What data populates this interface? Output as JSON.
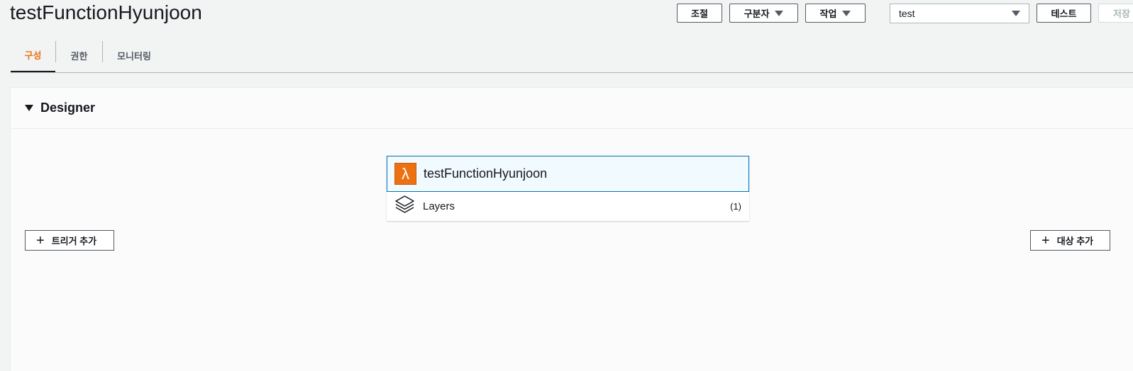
{
  "header": {
    "title": "testFunctionHyunjoon",
    "throttle_label": "조절",
    "qualifier_label": "구분자",
    "actions_label": "작업",
    "test_event_value": "test",
    "test_label": "테스트",
    "save_label": "저장"
  },
  "tabs": [
    {
      "label": "구성"
    },
    {
      "label": "권한"
    },
    {
      "label": "모니터링"
    }
  ],
  "designer": {
    "title": "Designer",
    "function_name": "testFunctionHyunjoon",
    "layers_label": "Layers",
    "layers_count": "(1)",
    "add_trigger_label": "트리거 추가",
    "add_destination_label": "대상 추가"
  },
  "colors": {
    "accent": "#ec7211",
    "selected_border": "#0073bb",
    "selected_bg": "#f1faff"
  }
}
